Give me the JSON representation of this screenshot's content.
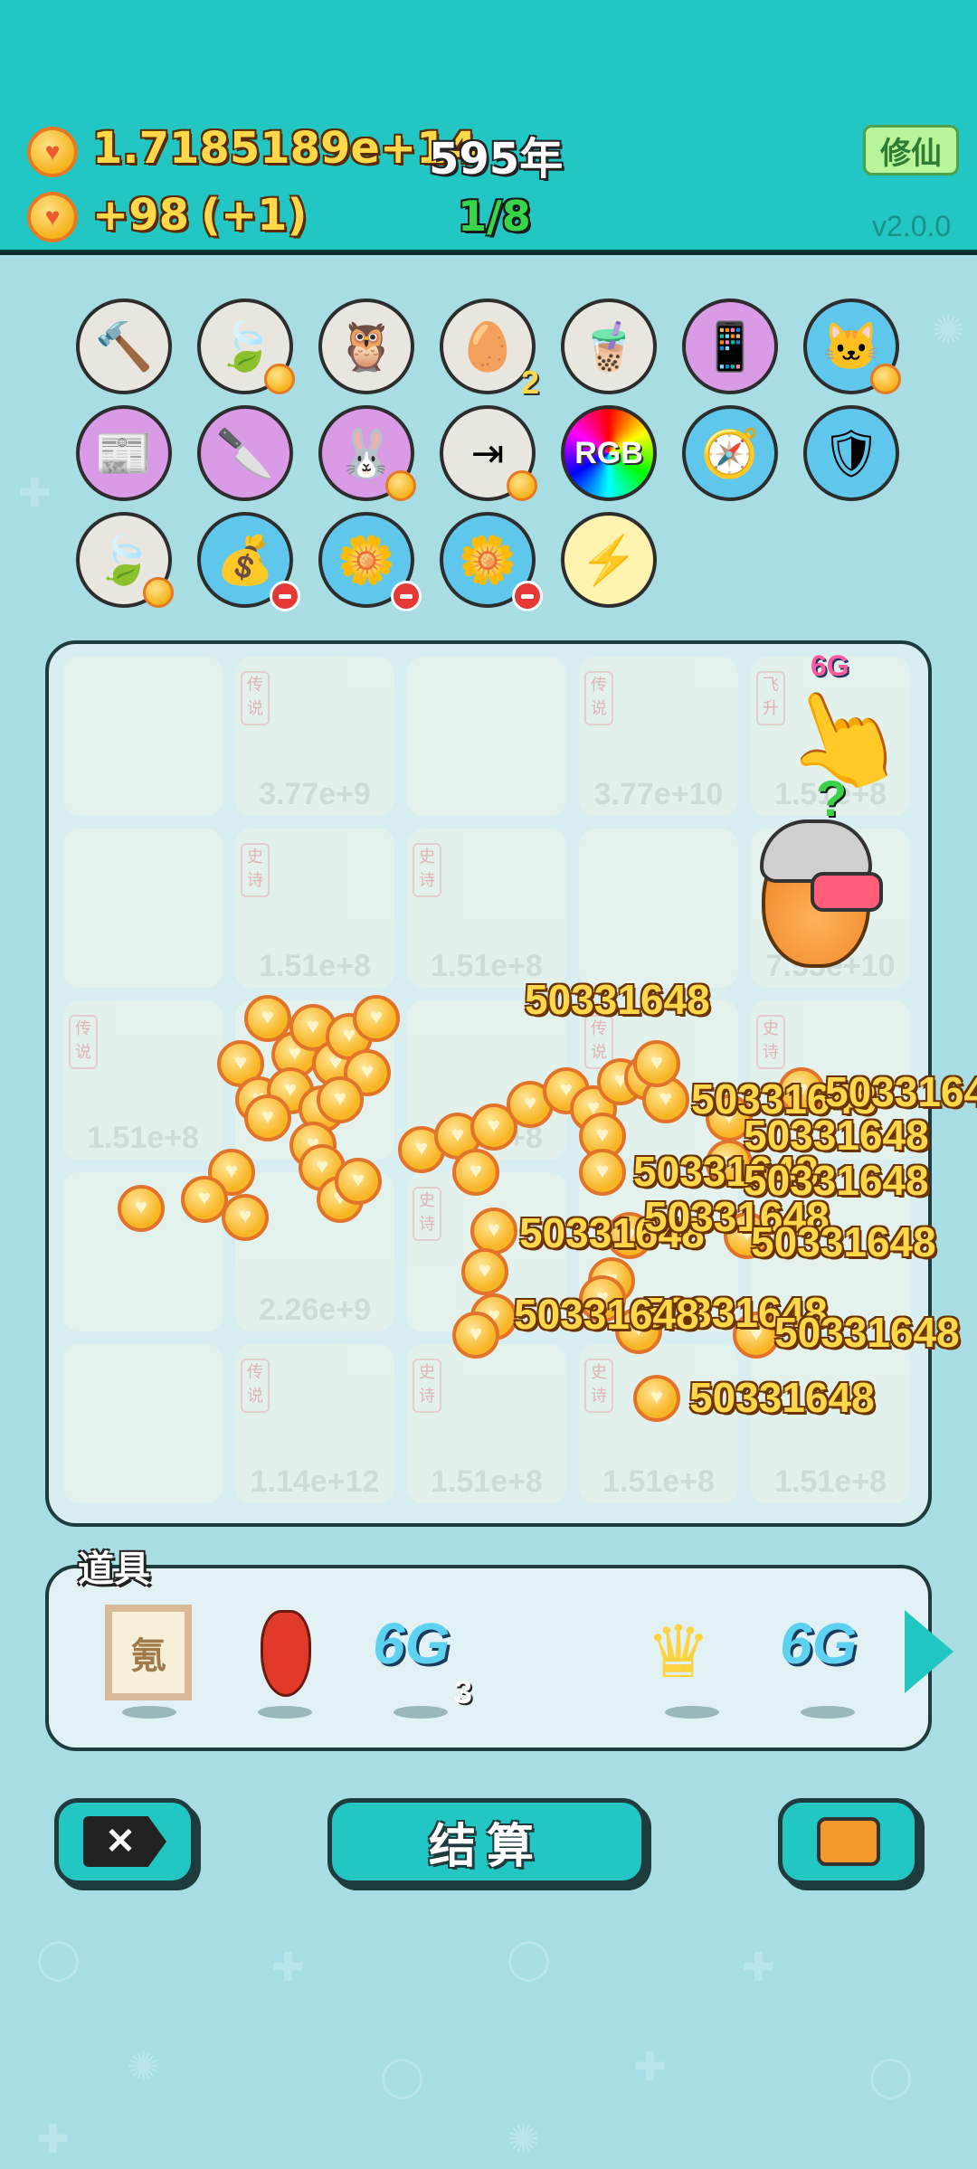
{
  "header": {
    "currency_value": "1.7185189e+14",
    "years": "595年",
    "income": "+98",
    "income_bonus": "(+1)",
    "stage": "1/8",
    "cultivate_button": "修仙",
    "version": "v2.0.0"
  },
  "skills": [
    {
      "icon": "hammer-icon"
    },
    {
      "icon": "leaf-icon"
    },
    {
      "icon": "owl-icon"
    },
    {
      "icon": "egg-tray-icon",
      "count": "2"
    },
    {
      "icon": "milk-tea-icon"
    },
    {
      "icon": "tablet-icon"
    },
    {
      "icon": "cat-icon"
    },
    {
      "icon": "time-magazine-icon"
    },
    {
      "icon": "cleaver-icon"
    },
    {
      "icon": "rabbit-icon"
    },
    {
      "icon": "skip-icon"
    },
    {
      "icon": "rgb-icon",
      "label": "RGB"
    },
    {
      "icon": "compass-icon"
    },
    {
      "icon": "shield-icon"
    },
    {
      "icon": "leaf-icon"
    },
    {
      "icon": "money-bag-icon"
    },
    {
      "icon": "flower-pot-icon"
    },
    {
      "icon": "flower-pot-icon"
    },
    {
      "icon": "lightning-icon"
    }
  ],
  "board": {
    "cells": [
      {
        "tag": "",
        "caption": ""
      },
      {
        "tag": "传说",
        "caption": "3.77e+9"
      },
      {
        "tag": "",
        "caption": ""
      },
      {
        "tag": "传说",
        "caption": "3.77e+10"
      },
      {
        "tag": "飞升",
        "caption": "1.51e+8"
      },
      {
        "tag": "",
        "caption": ""
      },
      {
        "tag": "史诗",
        "caption": "1.51e+8"
      },
      {
        "tag": "史诗",
        "caption": "1.51e+8"
      },
      {
        "tag": "",
        "caption": ""
      },
      {
        "tag": "",
        "caption": "7.55e+10"
      },
      {
        "tag": "传说",
        "caption": "1.51e+8"
      },
      {
        "tag": "",
        "caption": ""
      },
      {
        "tag": "",
        "caption": "1.51e+8"
      },
      {
        "tag": "传说",
        "caption": ""
      },
      {
        "tag": "史诗",
        "caption": ""
      },
      {
        "tag": "",
        "caption": ""
      },
      {
        "tag": "",
        "caption": "2.26e+9"
      },
      {
        "tag": "史诗",
        "caption": "1"
      },
      {
        "tag": "",
        "caption": ""
      },
      {
        "tag": "",
        "caption": ""
      },
      {
        "tag": "",
        "caption": ""
      },
      {
        "tag": "传说",
        "caption": "1.14e+12"
      },
      {
        "tag": "史诗",
        "caption": "1.51e+8"
      },
      {
        "tag": "史诗",
        "caption": "1.51e+8"
      },
      {
        "tag": "",
        "caption": "1.51e+8"
      }
    ],
    "badge_6g": "6G",
    "question": "?",
    "floating_values": [
      "50331648",
      "50331648",
      "50331648",
      "50331648",
      "50331648",
      "50331648",
      "50331648",
      "50331648",
      "50331648",
      "50331648",
      "50331648",
      "50331648"
    ]
  },
  "items": {
    "title": "道具",
    "list": [
      {
        "icon": "krypton-frame-icon",
        "label": "氪"
      },
      {
        "icon": "chili-pepper-icon",
        "label": ""
      },
      {
        "icon": "6g-icon",
        "label": "6G",
        "count": "3"
      },
      {
        "icon": "crown-icon",
        "label": ""
      },
      {
        "icon": "6g-icon",
        "label": "6G"
      }
    ]
  },
  "buttons": {
    "settle_label": "结算"
  }
}
